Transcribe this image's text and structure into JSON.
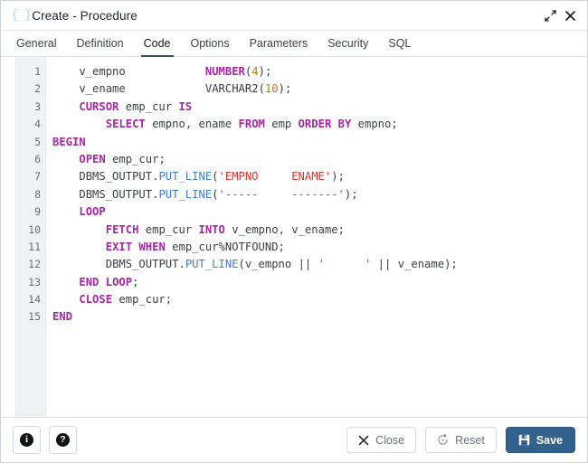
{
  "window": {
    "icon": "braces-icon",
    "icon_glyph": "{ }",
    "title": "Create - Procedure",
    "expand_label": "Expand",
    "close_label": "Close"
  },
  "tabs": [
    {
      "label": "General",
      "active": false
    },
    {
      "label": "Definition",
      "active": false
    },
    {
      "label": "Code",
      "active": true
    },
    {
      "label": "Options",
      "active": false
    },
    {
      "label": "Parameters",
      "active": false
    },
    {
      "label": "Security",
      "active": false
    },
    {
      "label": "SQL",
      "active": false
    }
  ],
  "editor": {
    "line_numbers": [
      "1",
      "2",
      "3",
      "4",
      "5",
      "6",
      "7",
      "8",
      "9",
      "10",
      "11",
      "12",
      "13",
      "14",
      "15"
    ],
    "lines": [
      "    v_empno            NUMBER(4);",
      "    v_ename            VARCHAR2(10);",
      "    CURSOR emp_cur IS",
      "        SELECT empno, ename FROM emp ORDER BY empno;",
      "BEGIN",
      "    OPEN emp_cur;",
      "    DBMS_OUTPUT.PUT_LINE('EMPNO     ENAME');",
      "    DBMS_OUTPUT.PUT_LINE('-----     -------');",
      "    LOOP",
      "        FETCH emp_cur INTO v_empno, v_ename;",
      "        EXIT WHEN emp_cur%NOTFOUND;",
      "        DBMS_OUTPUT.PUT_LINE(v_empno || '      ' || v_ename);",
      "    END LOOP;",
      "    CLOSE emp_cur;",
      "END"
    ]
  },
  "footer": {
    "info_label": "Information",
    "info_glyph": "i",
    "help_label": "Help",
    "help_glyph": "?",
    "close_label": "Close",
    "reset_label": "Reset",
    "save_label": "Save"
  },
  "colors": {
    "accent": "#32628c",
    "keyword": "#a626a4",
    "function": "#3f7fd1",
    "string": "#d9342b",
    "number": "#b07d14",
    "tab_underline": "#2f4a66"
  }
}
